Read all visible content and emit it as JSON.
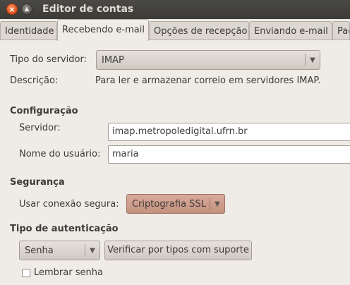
{
  "window": {
    "title": "Editor de contas"
  },
  "tabs": [
    {
      "label": "Identidade"
    },
    {
      "label": "Recebendo e-mail"
    },
    {
      "label": "Opções de recepção"
    },
    {
      "label": "Enviando e-mail"
    },
    {
      "label": "Pad"
    }
  ],
  "server_type": {
    "label": "Tipo do servidor:",
    "value": "IMAP",
    "description_label": "Descrição:",
    "description": "Para ler e armazenar correio em servidores IMAP."
  },
  "configuration": {
    "heading": "Configuração",
    "server_label": "Servidor:",
    "server_value": "imap.metropoledigital.ufrn.br",
    "user_label": "Nome do usuário:",
    "user_value": "maria"
  },
  "security": {
    "heading": "Segurança",
    "secure_label": "Usar conexão segura:",
    "secure_value": "Criptografia SSL"
  },
  "auth": {
    "heading": "Tipo de autenticação",
    "method_value": "Senha",
    "check_button": "Verificar por tipos com suporte",
    "remember_label": "Lembrar senha",
    "remember_checked": false
  }
}
